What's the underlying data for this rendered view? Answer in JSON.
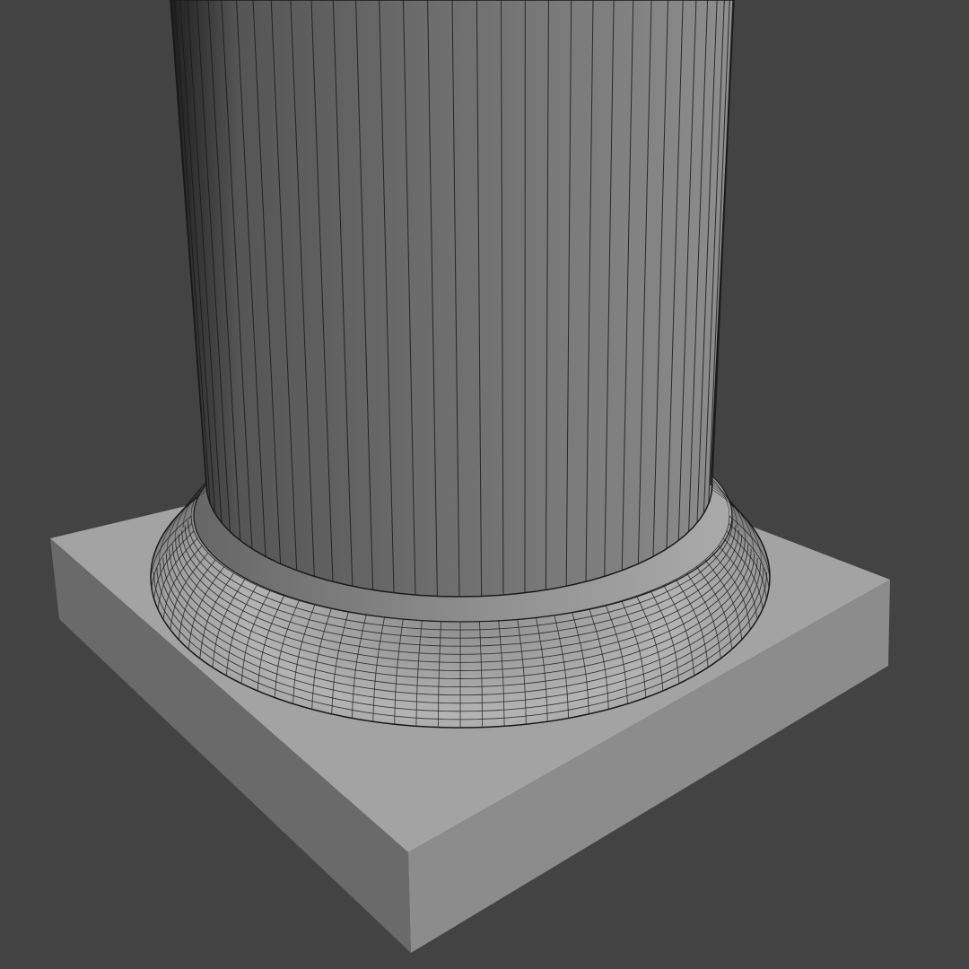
{
  "viewport": {
    "background_color": "#434343",
    "wire_color": "#1a1a1a"
  },
  "model": {
    "parts": [
      "square-plinth",
      "torus-base-molding",
      "fluted-column-shaft"
    ],
    "plinth_colors": {
      "top": "#a3a3a3",
      "left": "#6a6a6a",
      "front": "#8c8c8c"
    },
    "shaft_colors": {
      "shadow": "#2a2a2a",
      "mid": "#6e6e6e",
      "highlight": "#8a8a8a"
    },
    "torus_colors": {
      "dark": "#3a3a3a",
      "light": "#b8b8b8"
    }
  }
}
